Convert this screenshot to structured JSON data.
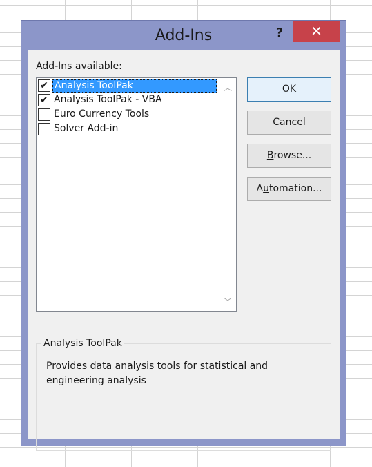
{
  "dialog": {
    "title": "Add-Ins",
    "help_glyph": "?",
    "close_glyph": "✕"
  },
  "addins": {
    "label_accel": "A",
    "label_rest": "dd-Ins available:",
    "items": [
      {
        "label": "Analysis ToolPak",
        "checked": true,
        "selected": true
      },
      {
        "label": "Analysis ToolPak - VBA",
        "checked": true,
        "selected": false
      },
      {
        "label": "Euro Currency Tools",
        "checked": false,
        "selected": false
      },
      {
        "label": "Solver Add-in",
        "checked": false,
        "selected": false
      }
    ],
    "check_glyph": "✔"
  },
  "scrollbar": {
    "up_glyph": "︿",
    "down_glyph": "﹀"
  },
  "buttons": {
    "ok": {
      "label": "OK"
    },
    "cancel": {
      "label": "Cancel"
    },
    "browse": {
      "accel": "B",
      "rest": "rowse..."
    },
    "automation": {
      "pre": "A",
      "accel": "u",
      "rest": "tomation..."
    }
  },
  "description": {
    "title": "Analysis ToolPak",
    "text": "Provides data analysis tools for statistical and engineering analysis"
  },
  "colors": {
    "frame": "#8c96c9",
    "close": "#c7424a",
    "selection": "#3399ff",
    "client": "#f0f0f0"
  }
}
